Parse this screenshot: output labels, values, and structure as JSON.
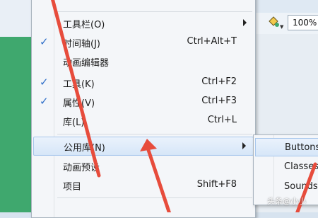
{
  "toolbar": {
    "zoom": "100%",
    "icon": "color-fill-icon"
  },
  "menu": {
    "items": [
      {
        "label": "工具栏(O)",
        "shortcut": "",
        "checked": false,
        "submenu": true
      },
      {
        "label": "时间轴(J)",
        "shortcut": "Ctrl+Alt+T",
        "checked": true,
        "submenu": false
      },
      {
        "label": "动画编辑器",
        "shortcut": "",
        "checked": false,
        "submenu": false
      },
      {
        "label": "工具(K)",
        "shortcut": "Ctrl+F2",
        "checked": true,
        "submenu": false
      },
      {
        "label": "属性(V)",
        "shortcut": "Ctrl+F3",
        "checked": true,
        "submenu": false
      },
      {
        "label": "库(L)",
        "shortcut": "Ctrl+L",
        "checked": false,
        "submenu": false
      },
      {
        "label": "公用库(N)",
        "shortcut": "",
        "checked": false,
        "submenu": true,
        "highlighted": true
      },
      {
        "label": "动画预设",
        "shortcut": "",
        "checked": false,
        "submenu": false
      },
      {
        "label": "项目",
        "shortcut": "Shift+F8",
        "checked": false,
        "submenu": false
      }
    ],
    "check_glyph": "✓"
  },
  "submenu": {
    "items": [
      {
        "label": "Buttons",
        "highlighted": true
      },
      {
        "label": "Classes"
      },
      {
        "label": "Sounds"
      }
    ]
  },
  "watermark": "头条@小小"
}
